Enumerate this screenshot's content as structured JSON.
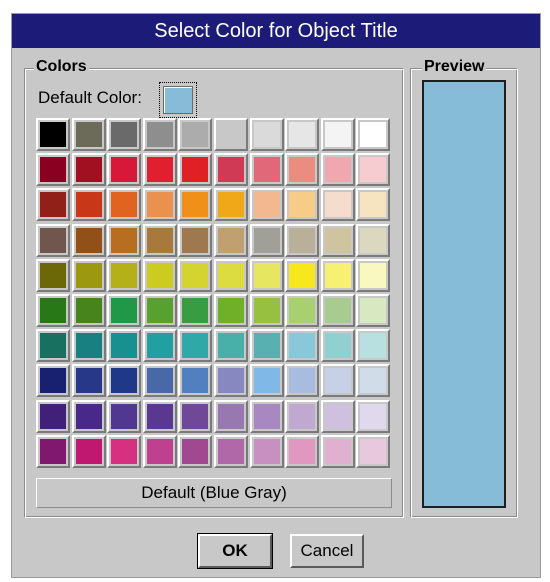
{
  "dialog": {
    "title": "Select Color for Object Title"
  },
  "colors_group": {
    "label": "Colors",
    "default_color_label": "Default Color:",
    "default_color_value": "#86bcd8",
    "default_bar_label": "Default (Blue Gray)"
  },
  "preview_group": {
    "label": "Preview",
    "color": "#86bcd8"
  },
  "palette": [
    [
      "#000000",
      "#6c6a58",
      "#6a6a6a",
      "#8e8e8e",
      "#acacac",
      "#c8c8c8",
      "#dadada",
      "#e6e6e6",
      "#f4f4f4",
      "#ffffff"
    ],
    [
      "#8a0020",
      "#a01020",
      "#d81838",
      "#e02030",
      "#e02024",
      "#d03a54",
      "#e06878",
      "#ea8c80",
      "#f0a8b0",
      "#f6ccd0"
    ],
    [
      "#902018",
      "#c83818",
      "#e06420",
      "#ec9050",
      "#f09018",
      "#f0a818",
      "#f4b890",
      "#f6cc88",
      "#f6dccc",
      "#f6e4c0"
    ],
    [
      "#70564c",
      "#905018",
      "#b86e20",
      "#a8783c",
      "#a07850",
      "#c0a070",
      "#a0a098",
      "#b8b098",
      "#d0c4a0",
      "#dcd8c0"
    ],
    [
      "#6c6808",
      "#9c9810",
      "#b4b018",
      "#cccc20",
      "#d4d430",
      "#dcdc40",
      "#e6e660",
      "#f6e81c",
      "#f8f070",
      "#f8f8c0"
    ],
    [
      "#287818",
      "#48841c",
      "#209848",
      "#58a030",
      "#389c40",
      "#70b028",
      "#98c040",
      "#a8d070",
      "#a8cc90",
      "#d8e8c0"
    ],
    [
      "#187060",
      "#188080",
      "#189090",
      "#20a0a0",
      "#30a8a8",
      "#48b0a8",
      "#58b0b0",
      "#88c8d8",
      "#90d0d0",
      "#b8e0e0"
    ],
    [
      "#182070",
      "#283888",
      "#203888",
      "#4868a8",
      "#5080c0",
      "#8888c0",
      "#80b8e8",
      "#a8bce0",
      "#c8d0e8",
      "#d0dce8"
    ],
    [
      "#402078",
      "#482888",
      "#503890",
      "#583890",
      "#704898",
      "#9878b0",
      "#a888c0",
      "#c0a8d0",
      "#d0c0e0",
      "#e0d8ec"
    ],
    [
      "#801870",
      "#c01870",
      "#d83080",
      "#c04090",
      "#a04890",
      "#b068a8",
      "#c890c0",
      "#e098c0",
      "#e0b0d0",
      "#e8c8dc"
    ]
  ],
  "buttons": {
    "ok": "OK",
    "cancel": "Cancel"
  }
}
